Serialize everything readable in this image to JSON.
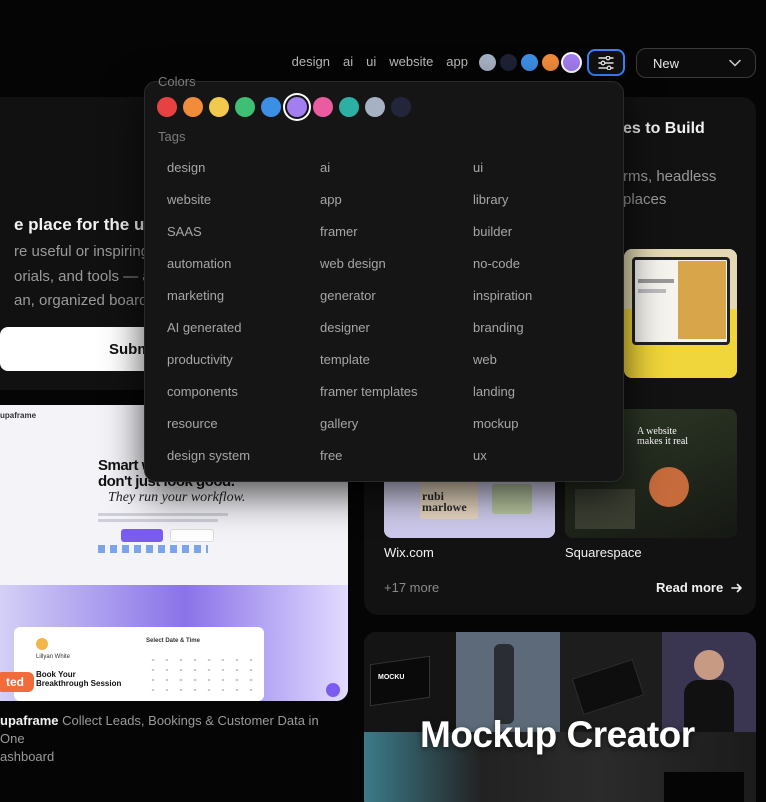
{
  "toolbar": {
    "quick_tags": [
      "design",
      "ai",
      "ui",
      "website",
      "app"
    ],
    "quick_colors": [
      "#a6b2c4",
      "#1e2234",
      "#3d8fe6",
      "#f08c3a",
      "#a27ef0"
    ],
    "quick_colors_selected": 4,
    "filter_icon": "sliders-icon",
    "sort_value": "New",
    "sort_icon": "chevron-down-icon"
  },
  "hero": {
    "title": "e place for the usef",
    "desc_lines": [
      "re useful or inspiring s",
      "orials, and tools — and",
      "an, organized boards."
    ],
    "submit_label": "Subm"
  },
  "build_card": {
    "title": "es to Build",
    "desc_lines": [
      "rms, headless",
      "places"
    ],
    "sites": [
      {
        "label": "Wix.com"
      },
      {
        "label": "Squarespace"
      }
    ],
    "more_label": "+17 more",
    "read_more_label": "Read more",
    "read_more_icon": "arrow-right-icon"
  },
  "tupaframe": {
    "name": "upaframe",
    "description": "Collect Leads, Bookings & Customer Data in One",
    "description_line2": "ashboard",
    "badge": "ted",
    "preview_headline_1": "Smart w",
    "preview_headline_2": "don't just look good.",
    "preview_headline_3": "They run your workflow.",
    "preview_brand": "upaframe",
    "preview_book": "Book Your",
    "preview_book_2": "Breakthrough Session",
    "preview_person": "Lillyan White",
    "preview_select": "Select Date & Time"
  },
  "mockup": {
    "title": "Mockup Creator",
    "brand": "MOCKU"
  },
  "filter_dropdown": {
    "colors_heading": "Colors",
    "colors": [
      "#e84141",
      "#f08c3a",
      "#f1c94c",
      "#3fbf73",
      "#3d8fe6",
      "#a27ef0",
      "#ea5ba0",
      "#2bb0a3",
      "#a6b2c4",
      "#23263a"
    ],
    "selected_color": 5,
    "tags_heading": "Tags",
    "tags": [
      "design",
      "ai",
      "ui",
      "website",
      "app",
      "library",
      "SAAS",
      "framer",
      "builder",
      "automation",
      "web design",
      "no-code",
      "marketing",
      "generator",
      "inspiration",
      "AI generated",
      "designer",
      "branding",
      "productivity",
      "template",
      "web",
      "components",
      "framer templates",
      "landing",
      "resource",
      "gallery",
      "mockup",
      "design system",
      "free",
      "ux"
    ]
  }
}
